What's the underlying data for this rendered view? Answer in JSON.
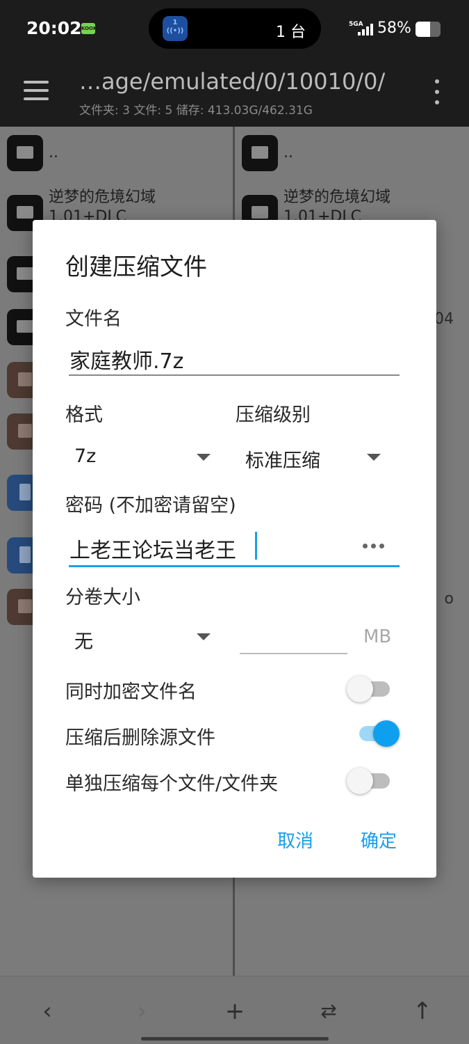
{
  "status_bar": {
    "time": "20:02",
    "badge": "KOOK",
    "island_icon_number": "1",
    "island_count": "1 台",
    "network": "5GA",
    "battery_percent": "58%",
    "battery_level": 0.58
  },
  "toolbar": {
    "path": "…age/emulated/0/10010/0/",
    "stats": "文件夹: 3  文件: 5  储存: 413.03G/462.31G"
  },
  "left_pane": {
    "items": [
      {
        "name": "..",
        "icon": "folder-icon"
      },
      {
        "name": "逆梦的危境幻域\n1.01+DLC",
        "icon": "folder-icon"
      },
      {
        "name": "",
        "icon": "folder-icon"
      },
      {
        "name": "",
        "icon": "folder-icon"
      },
      {
        "name": "",
        "icon": "archive-icon"
      },
      {
        "name": "",
        "icon": "archive-icon"
      },
      {
        "name": "",
        "icon": "document-icon"
      },
      {
        "name": "",
        "icon": "document-icon"
      },
      {
        "name": "",
        "icon": "archive-icon"
      }
    ]
  },
  "right_pane": {
    "items": [
      {
        "name": "..",
        "icon": "folder-icon"
      },
      {
        "name": "逆梦的危境幻域\n1.01+DLC",
        "icon": "folder-icon"
      }
    ],
    "side_text_1": "04",
    "side_text_2": "o"
  },
  "dialog": {
    "title": "创建压缩文件",
    "filename_label": "文件名",
    "filename_value": "家庭教师.7z",
    "format_label": "格式",
    "format_value": "7z",
    "level_label": "压缩级别",
    "level_value": "标准压缩",
    "password_label": "密码 (不加密请留空)",
    "password_value": "上老王论坛当老王",
    "volume_label": "分卷大小",
    "volume_value": "无",
    "volume_unit": "MB",
    "volume_input_value": "",
    "toggle_encrypt_names_label": "同时加密文件名",
    "toggle_encrypt_names_on": false,
    "toggle_delete_source_label": "压缩后删除源文件",
    "toggle_delete_source_on": true,
    "toggle_each_separately_label": "单独压缩每个文件/文件夹",
    "toggle_each_separately_on": false,
    "cancel_label": "取消",
    "confirm_label": "确定"
  },
  "bottom_bar": {
    "back_icon": "chevron-left-icon",
    "forward_icon": "chevron-right-icon",
    "add_icon": "plus-icon",
    "swap_icon": "swap-icon",
    "up_icon": "arrow-up-icon"
  },
  "colors": {
    "accent": "#1aa0e6",
    "toggle_on": "#0ea0ef",
    "toolbar_bg": "#1c1c1c"
  }
}
